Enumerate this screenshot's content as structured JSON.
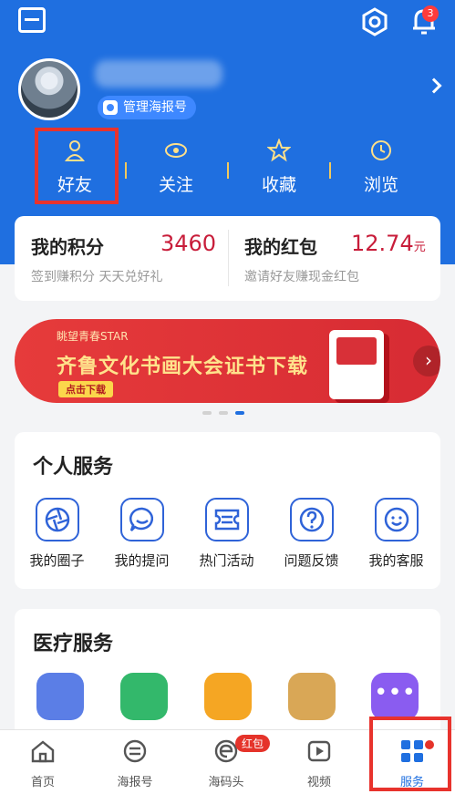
{
  "header": {
    "notification_count": "3",
    "manage_label": "管理海报号"
  },
  "stats": [
    {
      "label": "好友",
      "icon": "person-icon"
    },
    {
      "label": "关注",
      "icon": "eye-icon"
    },
    {
      "label": "收藏",
      "icon": "star-icon"
    },
    {
      "label": "浏览",
      "icon": "clock-icon"
    }
  ],
  "points": {
    "title": "我的积分",
    "value": "3460",
    "sub": "签到赚积分 天天兑好礼"
  },
  "redpacket": {
    "title": "我的红包",
    "value": "12.74",
    "unit": "元",
    "sub": "邀请好友赚现金红包"
  },
  "banner": {
    "subtitle": "眺望青春STAR",
    "title": "齐鲁文化书画大会证书下载",
    "button": "点击下载",
    "dots_total": 3,
    "dots_active": 3
  },
  "personal": {
    "title": "个人服务",
    "items": [
      {
        "label": "我的圈子",
        "icon": "aperture-icon"
      },
      {
        "label": "我的提问",
        "icon": "chat-bubble-icon"
      },
      {
        "label": "热门活动",
        "icon": "ticket-icon"
      },
      {
        "label": "问题反馈",
        "icon": "question-icon"
      },
      {
        "label": "我的客服",
        "icon": "smiley-icon"
      }
    ]
  },
  "medical": {
    "title": "医疗服务",
    "icons": [
      {
        "icon": "medkit-icon",
        "color": "#5b7ee6"
      },
      {
        "icon": "doctor-icon",
        "color": "#33b86b"
      },
      {
        "icon": "report-icon",
        "color": "#f5a623"
      },
      {
        "icon": "phone-plus-icon",
        "color": "#d9a756"
      },
      {
        "icon": "more-icon",
        "color": "#8a5cf0"
      }
    ]
  },
  "tabbar": {
    "badge": "红包",
    "items": [
      {
        "label": "首页",
        "icon": "home-icon"
      },
      {
        "label": "海报号",
        "icon": "poster-icon"
      },
      {
        "label": "海码头",
        "icon": "e-icon"
      },
      {
        "label": "视频",
        "icon": "play-icon"
      },
      {
        "label": "服务",
        "icon": "grid-icon",
        "active": true
      }
    ]
  },
  "colors": {
    "brand_blue": "#1f6fe0",
    "accent_red": "#c81d3a",
    "highlight_box": "#e8332d"
  }
}
